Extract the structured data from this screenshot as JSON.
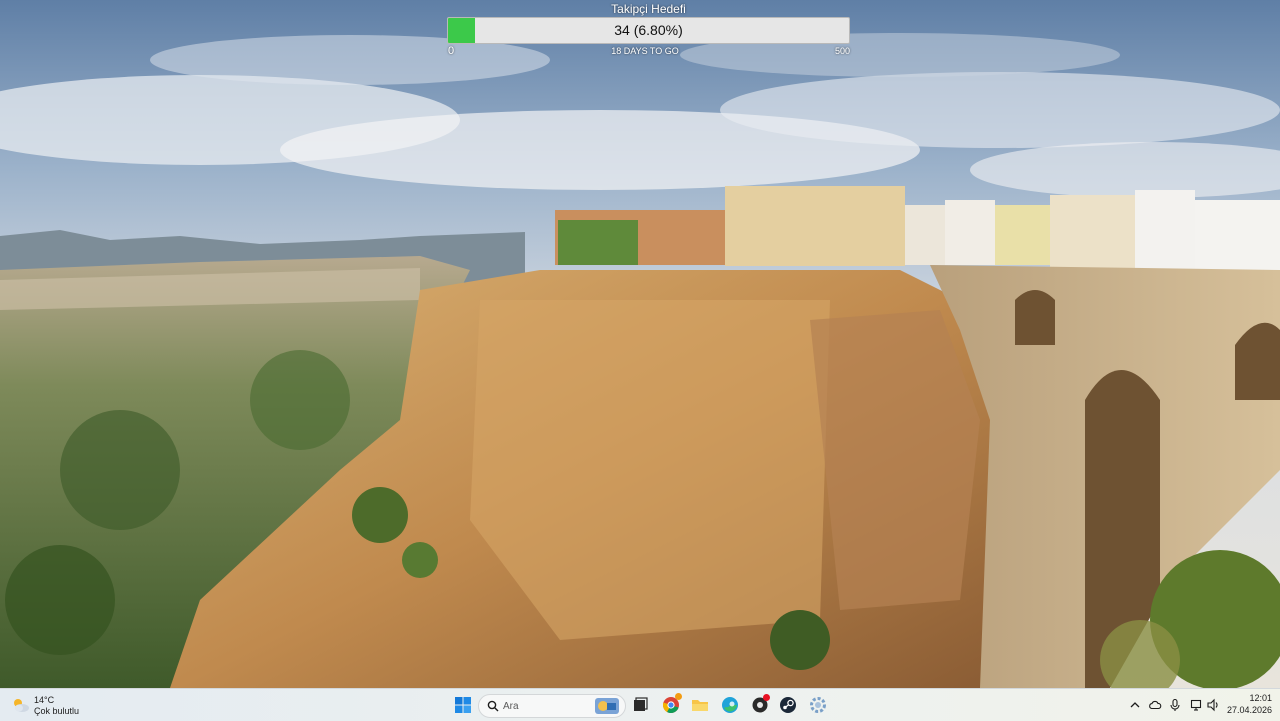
{
  "widget": {
    "title": "Takipçi Hedefi",
    "count_text": "34 (6.80%)",
    "progress": 0.068,
    "min_label": "0",
    "max_label": "500",
    "subtitle": "18 DAYS TO GO",
    "fill_color": "#3cc94a"
  },
  "taskbar": {
    "weather": {
      "temp": "14°C",
      "desc": "Çok bulutlu",
      "icon": "partly-cloudy-icon"
    },
    "search": {
      "placeholder": "Ara"
    },
    "apps": [
      "start-icon",
      "search-icon",
      "task-view-icon",
      "chrome-icon",
      "file-explorer-icon",
      "edge-icon",
      "app-icon",
      "steam-icon",
      "settings-icon"
    ],
    "tray_icons": [
      "chevron-up-icon",
      "cloud-icon",
      "microphone-icon",
      "network-icon",
      "speaker-icon"
    ],
    "clock": {
      "time": "12:01",
      "date": "27.04.2026"
    }
  }
}
